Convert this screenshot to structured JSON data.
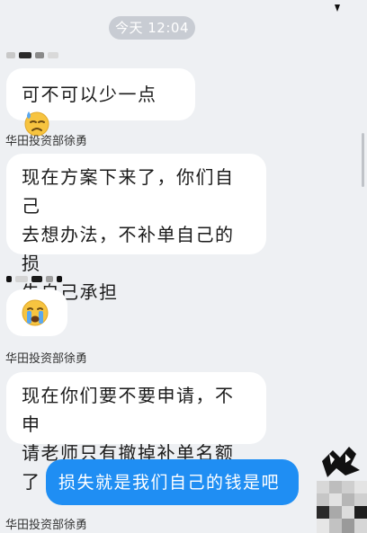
{
  "timestamp": "今天 12:04",
  "messages": [
    {
      "text": "可不可以少一点"
    },
    {
      "sender": "华田投资部徐勇",
      "lines": [
        "现在方案下来了，你们自己",
        "去想办法，不补单自己的损",
        "失自己承担"
      ]
    },
    {
      "sender": "华田投资部徐勇",
      "lines": [
        "现在你们要不要申请，不申",
        "请老师只有撤掉补单名额了"
      ]
    },
    {
      "text": "损失就是我们自己的钱是吧"
    },
    {
      "sender": "华田投资部徐勇"
    }
  ],
  "icons": {
    "sweat": "sweat-smile-emoji",
    "cry": "crying-emoji"
  },
  "colors": {
    "background": "#eef0f3",
    "outgoing_bubble": "#1f8ef3",
    "incoming_bubble": "#ffffff"
  }
}
